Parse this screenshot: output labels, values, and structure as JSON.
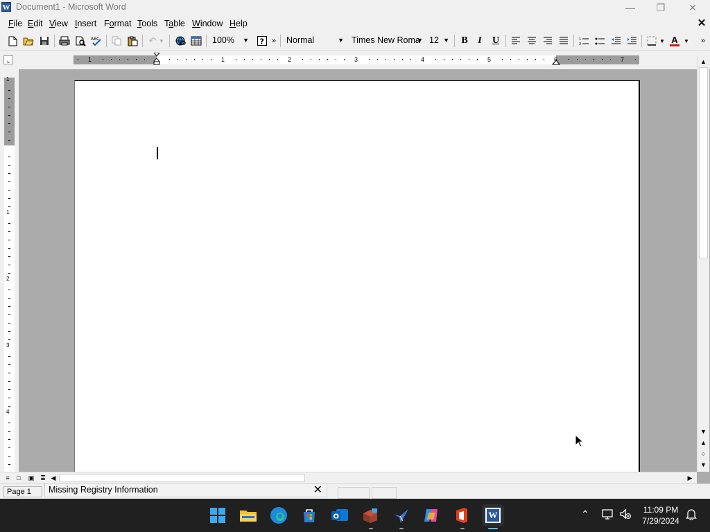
{
  "window": {
    "title": "Document1 - Microsoft Word",
    "app_icon_letter": "W"
  },
  "menu": {
    "items": [
      {
        "key": "F",
        "rest": "ile"
      },
      {
        "key": "E",
        "rest": "dit"
      },
      {
        "key": "V",
        "rest": "iew"
      },
      {
        "key": "I",
        "rest": "nsert"
      },
      {
        "pre": "F",
        "key": "o",
        "rest": "rmat"
      },
      {
        "key": "T",
        "rest": "ools"
      },
      {
        "pre": "T",
        "key": "a",
        "rest": "ble"
      },
      {
        "key": "W",
        "rest": "indow"
      },
      {
        "key": "H",
        "rest": "elp"
      }
    ]
  },
  "toolbar": {
    "zoom": "100%",
    "style": "Normal",
    "font": "Times New Roma",
    "size": "12",
    "bold": "B",
    "italic": "I",
    "underline": "U",
    "font_color_letter": "A",
    "font_color": "#d01818",
    "help_glyph": "?"
  },
  "ruler": {
    "h_numbers": [
      "1",
      "1",
      "2",
      "3",
      "4",
      "5",
      "6",
      "7"
    ],
    "v_numbers": [
      "1",
      "1",
      "2",
      "3",
      "4"
    ]
  },
  "statusbar": {
    "page": "Page  1",
    "popup_text": "Missing Registry Information"
  },
  "taskbar": {
    "time": "11:09 PM",
    "date": "7/29/2024",
    "apps": [
      "windows-start-icon",
      "file-explorer-icon",
      "edge-icon",
      "microsoft-store-icon",
      "outlook-new-icon",
      "app-box-icon",
      "bird-app-icon",
      "copilot-icon",
      "office-icon",
      "word-icon"
    ]
  },
  "colors": {
    "taskbar_bg": "#202020",
    "chrome_bg": "#f0f0f0",
    "workspace_bg": "#ababab",
    "word_blue": "#2b579a"
  }
}
